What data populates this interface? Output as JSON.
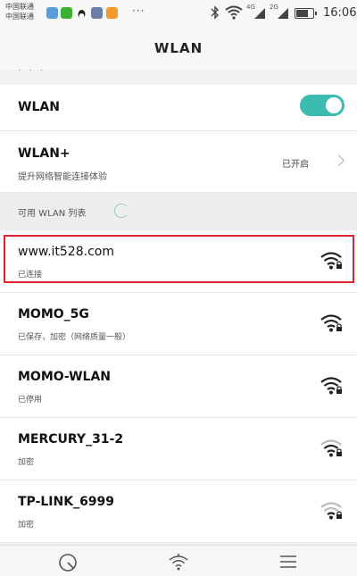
{
  "status_bar": {
    "carrier_1": "中国联通",
    "carrier_2": "中国联通",
    "more_dots": "···",
    "network_1": "4G",
    "network_2": "2G",
    "battery_level": 0.75,
    "time": "16:06"
  },
  "header": {
    "title": "WLAN",
    "partial_text": "· · ·"
  },
  "wlan_toggle": {
    "label": "WLAN",
    "on": true,
    "color": "#3cbbb1"
  },
  "wlan_plus": {
    "label": "WLAN+",
    "sublabel": "提升网络智能连接体验",
    "status": "已开启"
  },
  "available_section": {
    "title": "可用 WLAN 列表"
  },
  "networks": [
    {
      "ssid": "www.it528.com",
      "status": "已连接"
    },
    {
      "ssid": "MOMO_5G",
      "status": "已保存，加密（网络质量一般）"
    },
    {
      "ssid": "MOMO-WLAN",
      "status": "已停用"
    },
    {
      "ssid": "MERCURY_31-2",
      "status": "加密"
    },
    {
      "ssid": "TP-LINK_6999",
      "status": "加密"
    }
  ],
  "colors": {
    "highlight": "#e0232d",
    "accent": "#3cbbb1"
  },
  "bottom_nav": {
    "icons": [
      "scan-icon",
      "wifi-settings-icon",
      "menu-icon"
    ]
  }
}
